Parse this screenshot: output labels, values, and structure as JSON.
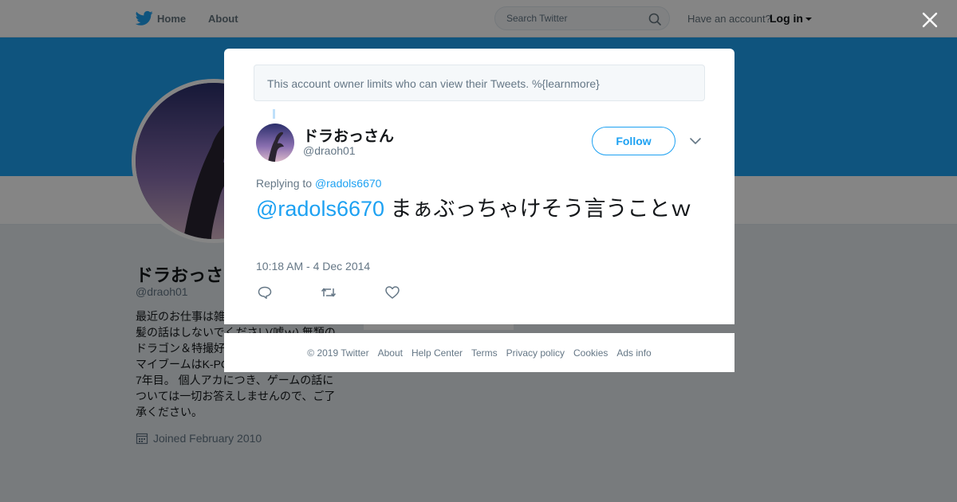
{
  "topbar": {
    "home_label": "Home",
    "about_label": "About",
    "search_placeholder": "Search Twitter",
    "have_account": "Have an account?",
    "login_label": "Log in"
  },
  "profile": {
    "name": "ドラおっさ",
    "handle": "@draoh01",
    "bio": "最近のお仕事は雑\n髪の話はしないでください(嘘ｗ) 無類の\nドラゴン＆特撮好\nマイブームはK-PO\n7年目。 個人アカにつき、ゲームの話に\nついては一切お答えしませんので、ご了\n承ください。",
    "joined": "Joined February 2010"
  },
  "modal": {
    "notice": "This account owner limits who can view their Tweets. %{learnmore}",
    "tweet": {
      "author_name": "ドラおっさん",
      "author_handle": "@draoh01",
      "follow_label": "Follow",
      "replying_prefix": "Replying to",
      "replying_to": "@radols6670",
      "mention": "@radols6670",
      "text": " まぁぶっちゃけそう言うことｗ",
      "timestamp": "10:18 AM - 4 Dec 2014"
    }
  },
  "footer": {
    "copyright": "© 2019 Twitter",
    "links": [
      "About",
      "Help Center",
      "Terms",
      "Privacy policy",
      "Cookies",
      "Ads info"
    ]
  },
  "colors": {
    "brand": "#1da1f2",
    "overlay": "rgba(0,0,0,0.48)",
    "secondary_text": "#657786"
  },
  "icons": [
    "twitter-bird-icon",
    "search-icon",
    "close-icon",
    "chevron-down-icon",
    "reply-icon",
    "retweet-icon",
    "like-icon",
    "calendar-icon"
  ]
}
